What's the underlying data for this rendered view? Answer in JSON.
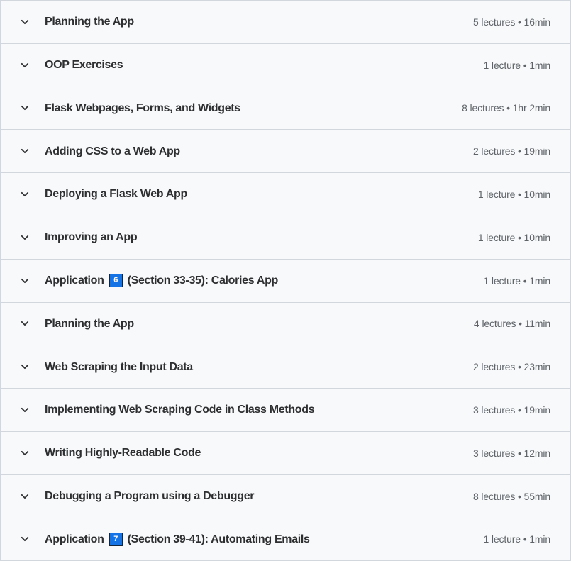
{
  "curriculum": {
    "icons": {
      "collapse_chevron": "chevron-down-icon"
    },
    "sections": [
      {
        "title": "Planning the App",
        "title_pre": "Planning the App",
        "badge": null,
        "title_post": "",
        "meta": "5 lectures • 16min",
        "lectures": 5,
        "duration": "16min"
      },
      {
        "title": "OOP Exercises",
        "title_pre": "OOP Exercises",
        "badge": null,
        "title_post": "",
        "meta": "1 lecture • 1min",
        "lectures": 1,
        "duration": "1min"
      },
      {
        "title": "Flask Webpages, Forms, and Widgets",
        "title_pre": "Flask Webpages, Forms, and Widgets",
        "badge": null,
        "title_post": "",
        "meta": "8 lectures • 1hr 2min",
        "lectures": 8,
        "duration": "1hr 2min"
      },
      {
        "title": "Adding CSS to a Web App",
        "title_pre": "Adding CSS to a Web App",
        "badge": null,
        "title_post": "",
        "meta": "2 lectures • 19min",
        "lectures": 2,
        "duration": "19min"
      },
      {
        "title": "Deploying a Flask Web App",
        "title_pre": "Deploying a Flask Web App",
        "badge": null,
        "title_post": "",
        "meta": "1 lecture • 10min",
        "lectures": 1,
        "duration": "10min"
      },
      {
        "title": "Improving an App",
        "title_pre": "Improving an App",
        "badge": null,
        "title_post": "",
        "meta": "1 lecture • 10min",
        "lectures": 1,
        "duration": "10min"
      },
      {
        "title": "Application 6 (Section 33-35): Calories App",
        "title_pre": "Application",
        "badge": "6",
        "title_post": "(Section 33-35): Calories App",
        "meta": "1 lecture • 1min",
        "lectures": 1,
        "duration": "1min"
      },
      {
        "title": "Planning the App",
        "title_pre": "Planning the App",
        "badge": null,
        "title_post": "",
        "meta": "4 lectures • 11min",
        "lectures": 4,
        "duration": "11min"
      },
      {
        "title": "Web Scraping the Input Data",
        "title_pre": "Web Scraping the Input Data",
        "badge": null,
        "title_post": "",
        "meta": "2 lectures • 23min",
        "lectures": 2,
        "duration": "23min"
      },
      {
        "title": "Implementing Web Scraping Code in Class Methods",
        "title_pre": "Implementing Web Scraping Code in Class Methods",
        "badge": null,
        "title_post": "",
        "meta": "3 lectures • 19min",
        "lectures": 3,
        "duration": "19min"
      },
      {
        "title": "Writing Highly-Readable Code",
        "title_pre": "Writing Highly-Readable Code",
        "badge": null,
        "title_post": "",
        "meta": "3 lectures • 12min",
        "lectures": 3,
        "duration": "12min"
      },
      {
        "title": "Debugging a Program using a Debugger",
        "title_pre": "Debugging a Program using a Debugger",
        "badge": null,
        "title_post": "",
        "meta": "8 lectures • 55min",
        "lectures": 8,
        "duration": "55min"
      },
      {
        "title": "Application 7 (Section 39-41): Automating Emails",
        "title_pre": "Application",
        "badge": "7",
        "title_post": "(Section 39-41): Automating Emails",
        "meta": "1 lecture • 1min",
        "lectures": 1,
        "duration": "1min"
      }
    ],
    "colors": {
      "row_background": "#f7f9fa",
      "divider": "#d1d7dc",
      "title_text": "#2d2f31",
      "meta_text": "#5f6368",
      "badge_fill": "#1673e6",
      "badge_border": "#14263c",
      "badge_text": "#ffffff"
    }
  }
}
